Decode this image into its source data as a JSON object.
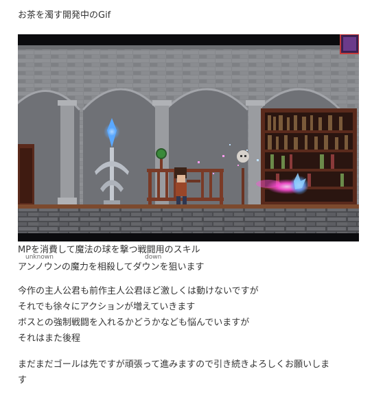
{
  "post": {
    "intro": "お茶を濁す開発中のGif",
    "caption_line1": "MPを消費して魔法の球を撃つ戦闘用のスキル",
    "ruby_unknown": "unknown",
    "ruby_down": "down",
    "caption_line2": "アンノウンの魔力を相殺してダウンを狙います",
    "paragraph1": [
      "今作の主人公君も前作主人公君ほど激しくは動けないですが",
      "それでも徐々にアクションが増えていきます",
      "ボスとの強制戦闘を入れるかどうかなども悩んでいますが",
      "それはまた後程"
    ],
    "paragraph2": [
      "まだまだゴールは先ですが頑張って進みますので引き続きよろしくお願いしま",
      "す"
    ]
  },
  "colors": {
    "text": "#333333",
    "stone": "#8a8c90",
    "stone_dark": "#5b5d62",
    "wood": "#6b3423",
    "magic_blue": "#5aa8ff",
    "magic_pink": "#ff4fd8"
  }
}
